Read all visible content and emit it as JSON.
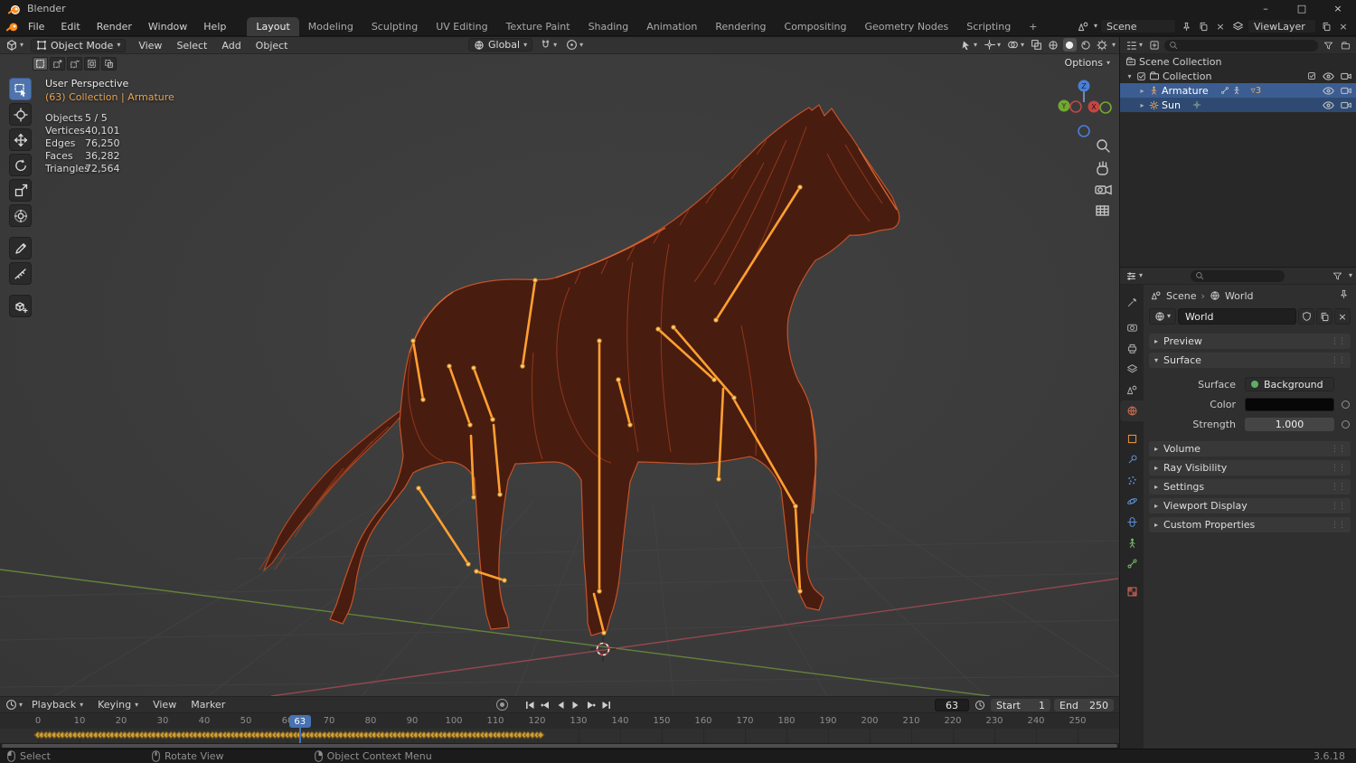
{
  "titlebar": {
    "title": "Blender"
  },
  "topbar": {
    "menus": [
      "File",
      "Edit",
      "Render",
      "Window",
      "Help"
    ],
    "workspaces": [
      "Layout",
      "Modeling",
      "Sculpting",
      "UV Editing",
      "Texture Paint",
      "Shading",
      "Animation",
      "Rendering",
      "Compositing",
      "Geometry Nodes",
      "Scripting"
    ],
    "add_workspace": "+",
    "scene_name": "Scene",
    "view_layer_name": "ViewLayer"
  },
  "viewport": {
    "header": {
      "mode": "Object Mode",
      "menus": [
        "View",
        "Select",
        "Add",
        "Object"
      ],
      "orientation": "Global",
      "options_label": "Options"
    },
    "overlay": {
      "view_name": "User Perspective",
      "context": "(63) Collection | Armature",
      "stats": [
        {
          "label": "Objects",
          "value": "5 / 5"
        },
        {
          "label": "Vertices",
          "value": "40,101"
        },
        {
          "label": "Edges",
          "value": "76,250"
        },
        {
          "label": "Faces",
          "value": "36,282"
        },
        {
          "label": "Triangles",
          "value": "72,564"
        }
      ]
    },
    "gizmo_axes": {
      "x": "X",
      "y": "Y",
      "z": "Z"
    }
  },
  "outliner": {
    "rows": [
      {
        "label": "Scene Collection"
      },
      {
        "label": "Collection"
      },
      {
        "label": "Armature",
        "badge": "3"
      },
      {
        "label": "Sun"
      }
    ]
  },
  "properties": {
    "breadcrumb": {
      "scene": "Scene",
      "world": "World"
    },
    "datablock_name": "World",
    "panels": [
      {
        "label": "Preview"
      },
      {
        "label": "Surface"
      },
      {
        "label": "Volume"
      },
      {
        "label": "Ray Visibility"
      },
      {
        "label": "Settings"
      },
      {
        "label": "Viewport Display"
      },
      {
        "label": "Custom Properties"
      }
    ],
    "surface": {
      "surface_label": "Surface",
      "surface_value": "Background",
      "color_label": "Color",
      "strength_label": "Strength",
      "strength_value": "1.000"
    }
  },
  "timeline": {
    "menus": [
      "Playback",
      "Keying",
      "View",
      "Marker"
    ],
    "current_frame": "63",
    "current_frame_num": 63,
    "start_label": "Start",
    "start_value": "1",
    "end_label": "End",
    "end_value": "250",
    "tick_min": 0,
    "tick_max": 250,
    "tick_step": 10,
    "keyframe_start": 0,
    "keyframe_end": 121
  },
  "statusbar": {
    "items": [
      {
        "label": "Select"
      },
      {
        "label": "Rotate View"
      },
      {
        "label": "Object Context Menu"
      }
    ],
    "version": "3.6.18"
  }
}
